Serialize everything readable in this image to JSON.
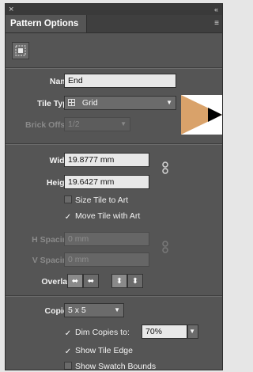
{
  "window": {
    "close_glyph": "×",
    "collapse_glyph": "«",
    "title": "Pattern Options",
    "menu_glyph": "≡"
  },
  "form": {
    "name_label": "Name:",
    "name_value": "End",
    "tile_type_label": "Tile Type:",
    "tile_type_value": "Grid",
    "brick_offset_label": "Brick Offset:",
    "brick_offset_value": "1/2",
    "width_label": "Width:",
    "width_value": "19.8777 mm",
    "height_label": "Height:",
    "height_value": "19.6427 mm",
    "size_tile_to_art": "Size Tile to Art",
    "size_tile_to_art_checked": false,
    "move_tile_with_art": "Move Tile with Art",
    "move_tile_with_art_checked": true,
    "h_spacing_label": "H Spacing:",
    "h_spacing_value": "0 mm",
    "v_spacing_label": "V Spacing:",
    "v_spacing_value": "0 mm",
    "overlap_label": "Overlap:",
    "copies_label": "Copies:",
    "copies_value": "5 x 5",
    "dim_copies_label": "Dim Copies to:",
    "dim_copies_checked": true,
    "dim_copies_value": "70%",
    "show_tile_edge": "Show Tile Edge",
    "show_tile_edge_checked": true,
    "show_swatch_bounds": "Show Swatch Bounds",
    "show_swatch_bounds_checked": false
  },
  "colors": {
    "panel_bg": "#555555",
    "preview_fill": "#d9a26a",
    "preview_arrow": "#000000"
  },
  "icons": {
    "tile_tool": "tile-edit-icon",
    "grid": "grid-icon",
    "link": "link-icon",
    "overlap_left": "left-in-front-icon",
    "overlap_right": "right-in-front-icon",
    "overlap_top": "top-in-front-icon",
    "overlap_bottom": "bottom-in-front-icon",
    "caret": "chevron-down-icon",
    "check": "checkmark-icon"
  }
}
